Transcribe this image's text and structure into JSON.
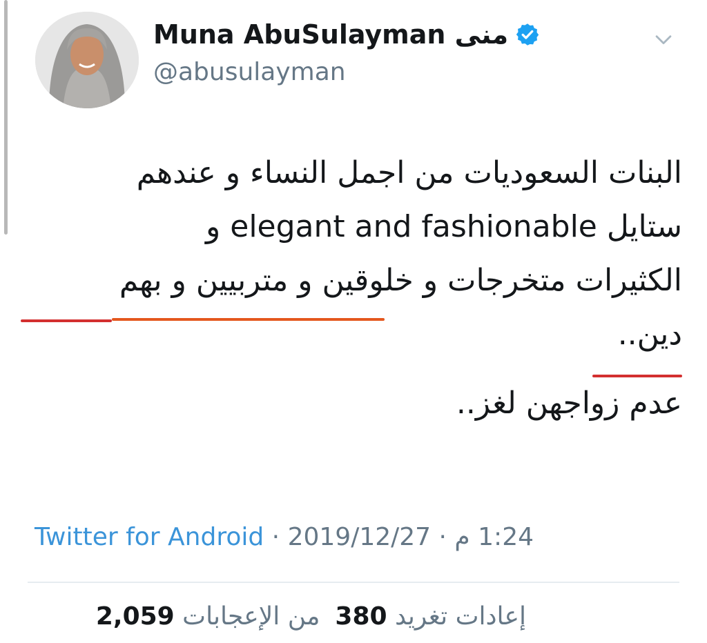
{
  "user": {
    "display_name": "Muna AbuSulayman منى",
    "handle": "@abusulayman",
    "verified_icon": "verified-badge-icon"
  },
  "tweet": {
    "line1": "البنات السعوديات من اجمل النساء و عندهم",
    "line2": "ستايل elegant and fashionable و",
    "line3": "الكثيرات متخرجات و خلوقين و متربيين و بهم",
    "line4": "دين..",
    "line5": "عدم زواجهن لغز.."
  },
  "meta": {
    "source": "Twitter for Android",
    "separator1": " · ",
    "date": "2019/12/27",
    "separator2": " · ",
    "time": "1:24 م"
  },
  "stats": {
    "likes_count": "2,059",
    "likes_label": "من الإعجابات",
    "retweets_count": "380",
    "retweets_label": "إعادات تغريد"
  },
  "colors": {
    "link": "#3b94d9",
    "muted": "#657786",
    "underline_red": "#d32f2f",
    "underline_orange": "#e4571e",
    "verified": "#1da1f2"
  }
}
